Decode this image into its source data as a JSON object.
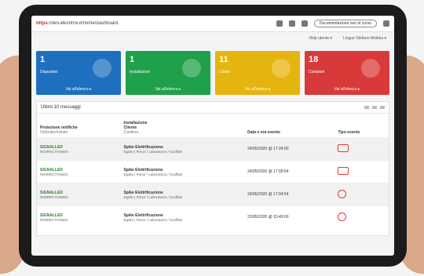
{
  "browser": {
    "protocol": "https",
    "url_rest": "://dev.elkontrol.it/home/dashboard",
    "pill_text": "Documentazione non in corso"
  },
  "nav": {
    "left": "Help utente ▾",
    "right": "Lingue Stefano Moleka ▾"
  },
  "cards": [
    {
      "number": "1",
      "label": "Dispositivi",
      "link": "Vai all'elenco",
      "color": "#1e6fbf",
      "icon": "wifi-icon"
    },
    {
      "number": "1",
      "label": "Installazioni",
      "link": "Vai all'elenco",
      "color": "#1fa04a",
      "icon": "building-icon"
    },
    {
      "number": "11",
      "label": "Clienti",
      "link": "Vai all'elenco",
      "color": "#e6b40e",
      "icon": "user-icon"
    },
    {
      "number": "18",
      "label": "Contatori",
      "link": "Vai all'elenco",
      "color": "#d83a3a",
      "icon": "grid-icon"
    }
  ],
  "panel": {
    "title": "Ultimi 10 messaggi"
  },
  "table": {
    "headers": {
      "c1_main": "Protezione notifiche",
      "c1_sub": "Ordinato/Inviato",
      "c2_main": "Installazione",
      "c2_line2": "Cliente",
      "c2_sub": "Cantiere",
      "c3": "Data e ora evento",
      "c4": "Tipo evento"
    },
    "rows": [
      {
        "c1": "SIGNALLED",
        "c1sub": "RIDIRECTIONED",
        "c2": "Spike Elettrificazione",
        "c2sub": "Egidio | Rimor / Laboratorio / Scaffale",
        "c3": "24/05/2020 @ 17:24:00",
        "type": "unlink"
      },
      {
        "c1": "SIGNALLED",
        "c1sub": "RIDIRECTIONED",
        "c2": "Spike Elettrificazione",
        "c2sub": "Egidio | Rimor / Laboratorio / Scaffale",
        "c3": "24/05/2020 @ 17:09:54",
        "type": "battery"
      },
      {
        "c1": "SIGNALLED",
        "c1sub": "RIDIRECTIONED",
        "c2": "Spike Elettrificazione",
        "c2sub": "Egidio | Rimor / Laboratorio / Scaffale",
        "c3": "24/05/2020 @ 17:04:54",
        "type": "power"
      },
      {
        "c1": "SIGNALLED",
        "c1sub": "RIDIRECTIONED",
        "c2": "Spike Elettrificazione",
        "c2sub": "Egidio | Rimor / Laboratorio / Scaffale",
        "c3": "22/05/2020 @ 15:49:00",
        "type": "power"
      }
    ]
  }
}
